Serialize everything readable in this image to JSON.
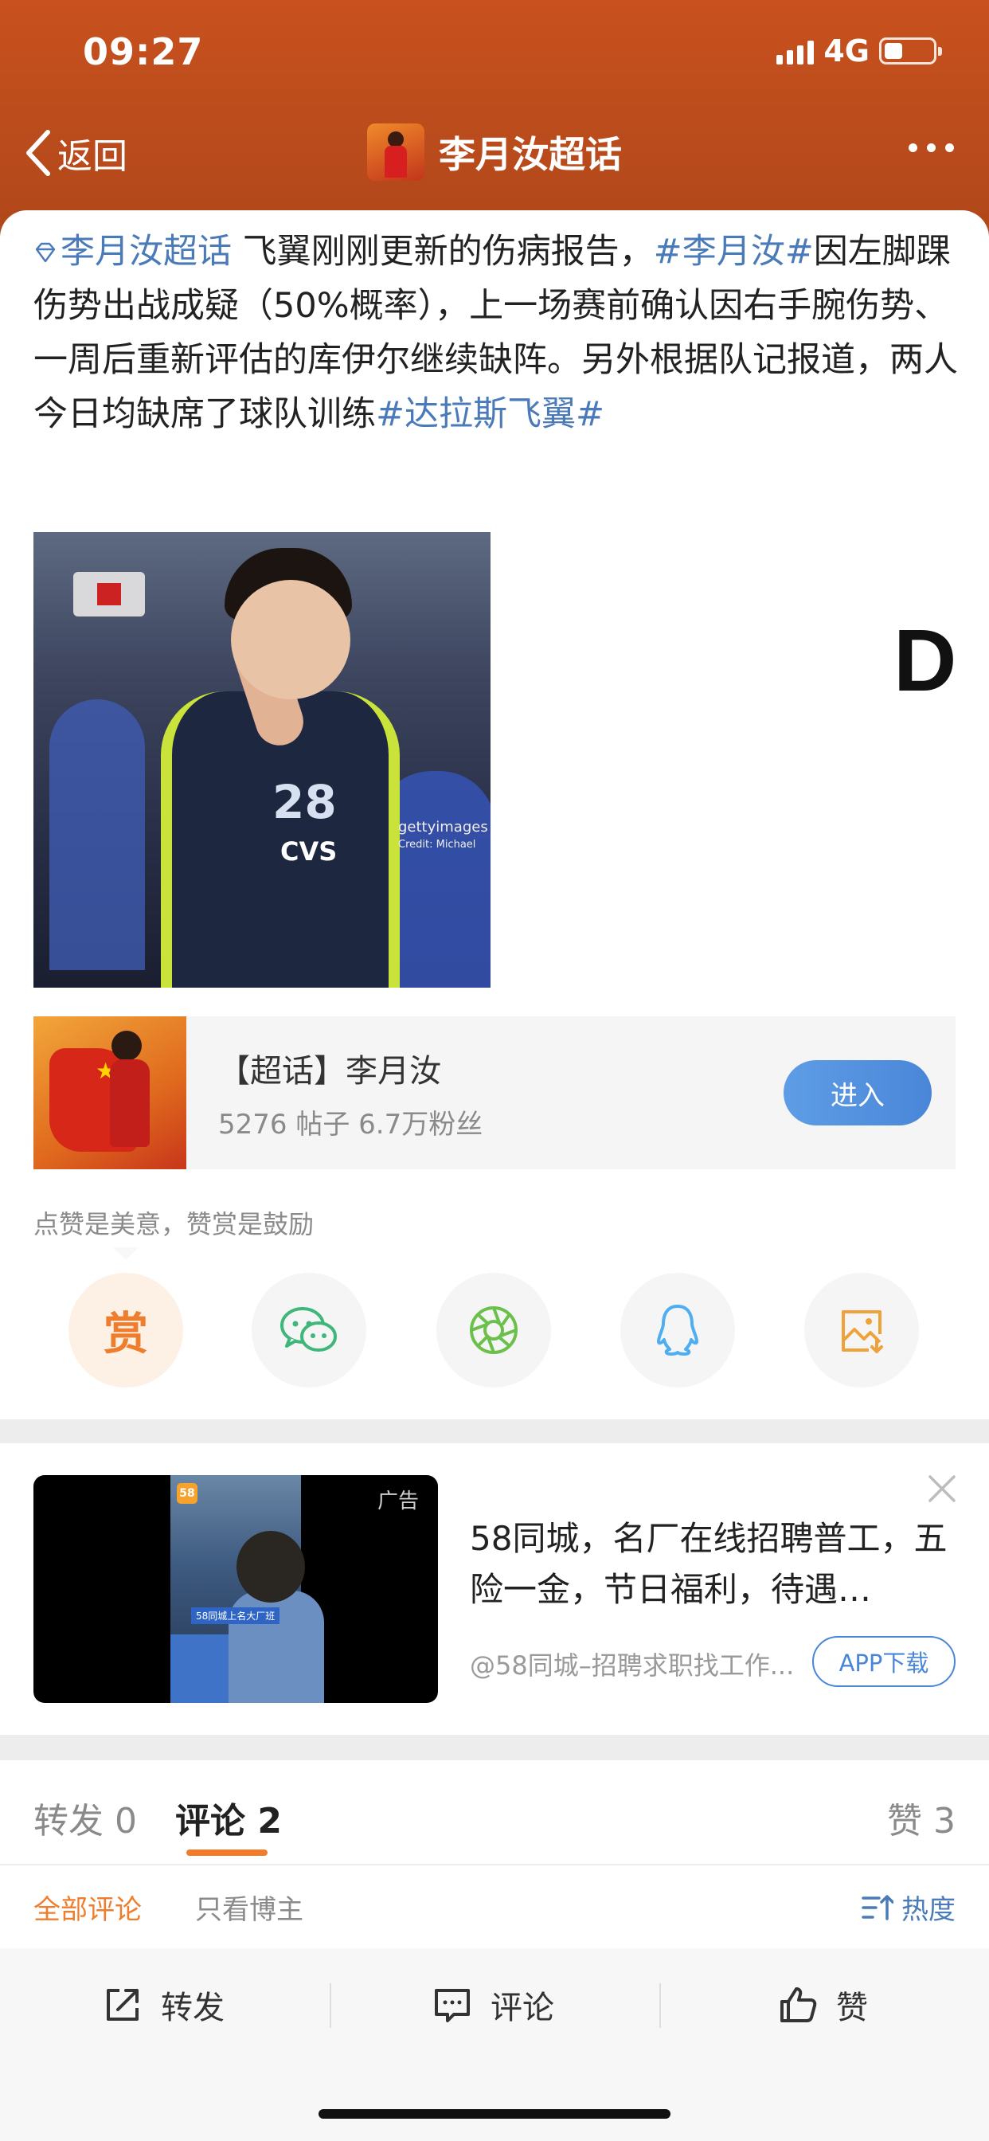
{
  "status_bar": {
    "time": "09:27",
    "network": "4G"
  },
  "nav": {
    "back_label": "返回",
    "title": "李月汝超话"
  },
  "post": {
    "topic_tag": "李月汝超话",
    "text_1": " 飞翼刚刚更新的伤病报告，",
    "hashtag_1": "#李月汝#",
    "text_2": "因左脚踝伤势出战成疑（50%概率），上一场赛前确认因右手腕伤势、一周后重新评估的库伊尔继续缺阵。另外根据队记报道，两人今日均缺席了球队训练",
    "hashtag_2": "#达拉斯飞翼#",
    "image": {
      "jersey_number": "28",
      "sponsor": "CVS",
      "credit": "gettyimages",
      "credit_2": "Credit: Michael"
    },
    "side_letter": "D"
  },
  "topic_card": {
    "name": "【超话】李月汝",
    "stats": "5276 帖子  6.7万粉丝",
    "enter_label": "进入"
  },
  "reward": {
    "tip": "点赞是美意，赞赏是鼓励",
    "reward_char": "赏",
    "share_icons": [
      "reward-icon",
      "wechat-icon",
      "moments-icon",
      "qq-icon",
      "save-image-icon"
    ]
  },
  "ad": {
    "label": "广告",
    "title": "58同城，名厂在线招聘普工，五险一金，节日福利，待遇…",
    "source": "@58同城–招聘求职找工作...",
    "app_button": "APP下载",
    "video_logo": "58",
    "video_caption": "58同城上名大厂班"
  },
  "tabs": {
    "repost": "转发 0",
    "comment": "评论 2",
    "like": "赞 3"
  },
  "filters": {
    "all": "全部评论",
    "owner_only": "只看博主",
    "sort": "热度"
  },
  "bottom_bar": {
    "repost": "转发",
    "comment": "评论",
    "like": "赞"
  },
  "colors": {
    "header": "#c8511e",
    "accent": "#ee7e2e",
    "link": "#4a7bb8",
    "button_blue": "#4a86d8"
  }
}
